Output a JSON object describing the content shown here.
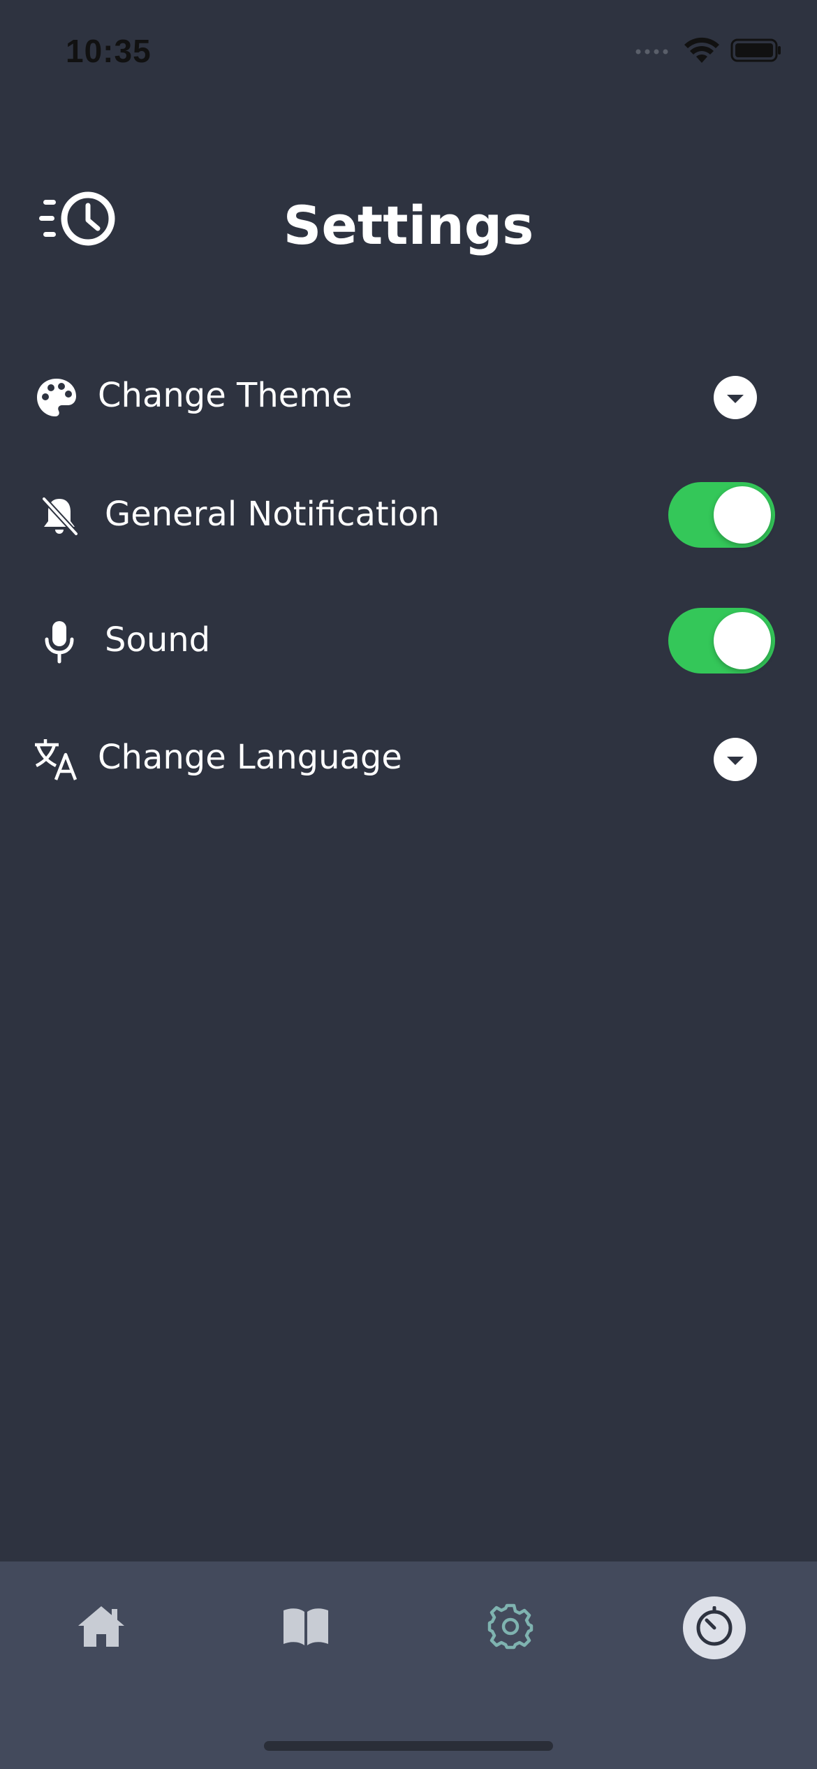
{
  "status_bar": {
    "time": "10:35",
    "icons": [
      "signal-icon",
      "wifi-icon",
      "battery-icon"
    ]
  },
  "header": {
    "title": "Settings",
    "left_icon": "history-clock-icon"
  },
  "settings": [
    {
      "icon": "palette-icon",
      "label": "Change Theme",
      "control": "dropdown"
    },
    {
      "icon": "bell-off-icon",
      "label": "General Notification",
      "control": "toggle",
      "value": true
    },
    {
      "icon": "microphone-icon",
      "label": "Sound",
      "control": "toggle",
      "value": true
    },
    {
      "icon": "translate-icon",
      "label": "Change Language",
      "control": "dropdown"
    }
  ],
  "tab_bar": {
    "items": [
      {
        "icon": "home-icon",
        "active": false
      },
      {
        "icon": "book-icon",
        "active": false
      },
      {
        "icon": "gear-icon",
        "active": false
      },
      {
        "icon": "timer-icon",
        "active": true
      }
    ]
  },
  "colors": {
    "background": "#2e3340",
    "tab_bar": "#434a5c",
    "toggle_on": "#34c759",
    "gear_accent": "#7fb3b0",
    "tab_icon": "#c8ccd4"
  }
}
